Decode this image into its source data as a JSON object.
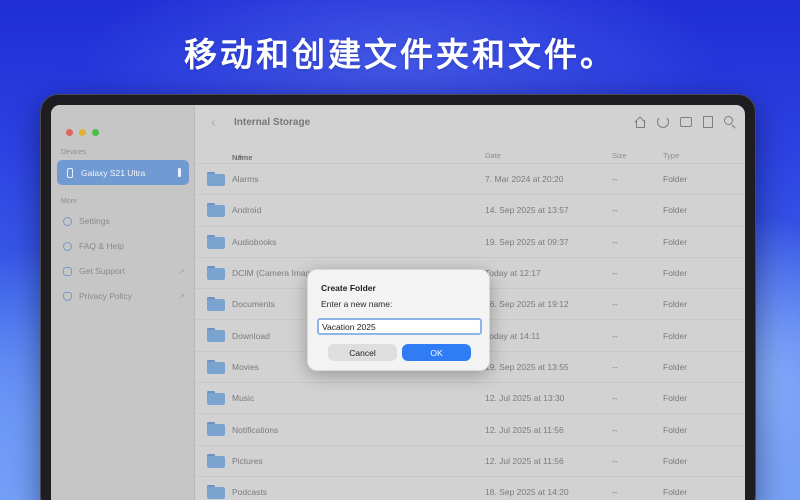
{
  "headline": "移动和创建文件夹和文件。",
  "sidebar": {
    "section_devices": "Devices",
    "active_device": "Galaxy S21 Ultra",
    "section_more": "More",
    "items": [
      {
        "label": "Settings",
        "icon": "gear-icon"
      },
      {
        "label": "FAQ & Help",
        "icon": "help-icon"
      },
      {
        "label": "Get Support",
        "icon": "chat-icon",
        "external": "↗"
      },
      {
        "label": "Privacy Policy",
        "icon": "hand-icon",
        "external": "↗"
      }
    ]
  },
  "toolbar": {
    "back": "‹",
    "title": "Internal Storage",
    "icons": [
      "home-icon",
      "refresh-icon",
      "new-folder-icon",
      "new-file-icon",
      "search-icon"
    ]
  },
  "table": {
    "headers": {
      "name": "Name",
      "sort": "^",
      "date": "Date",
      "size": "Size",
      "type": "Type"
    },
    "rows": [
      {
        "name": "Alarms",
        "date": "7. Mar 2024 at 20:20",
        "size": "--",
        "type": "Folder"
      },
      {
        "name": "Android",
        "date": "14. Sep 2025 at 13:57",
        "size": "--",
        "type": "Folder"
      },
      {
        "name": "Audiobooks",
        "date": "19. Sep 2025 at 09:37",
        "size": "--",
        "type": "Folder"
      },
      {
        "name": "DCIM (Camera Images)",
        "date": "Today at 12:17",
        "size": "--",
        "type": "Folder"
      },
      {
        "name": "Documents",
        "date": "16. Sep 2025 at 19:12",
        "size": "--",
        "type": "Folder"
      },
      {
        "name": "Download",
        "date": "Today at 14:11",
        "size": "--",
        "type": "Folder"
      },
      {
        "name": "Movies",
        "date": "19. Sep 2025 at 13:55",
        "size": "--",
        "type": "Folder"
      },
      {
        "name": "Music",
        "date": "12. Jul 2025 at 13:30",
        "size": "--",
        "type": "Folder"
      },
      {
        "name": "Notifications",
        "date": "12. Jul 2025 at 11:56",
        "size": "--",
        "type": "Folder"
      },
      {
        "name": "Pictures",
        "date": "12. Jul 2025 at 11:56",
        "size": "--",
        "type": "Folder"
      },
      {
        "name": "Podcasts",
        "date": "18. Sep 2025 at 14:20",
        "size": "--",
        "type": "Folder"
      }
    ]
  },
  "dialog": {
    "title": "Create Folder",
    "label": "Enter a new name:",
    "value": "Vacation 2025",
    "cancel": "Cancel",
    "ok": "OK"
  },
  "colors": {
    "accent": "#2f7cf5",
    "sidebar_active": "#6f9ad2",
    "folder": "#7aa3cf"
  }
}
